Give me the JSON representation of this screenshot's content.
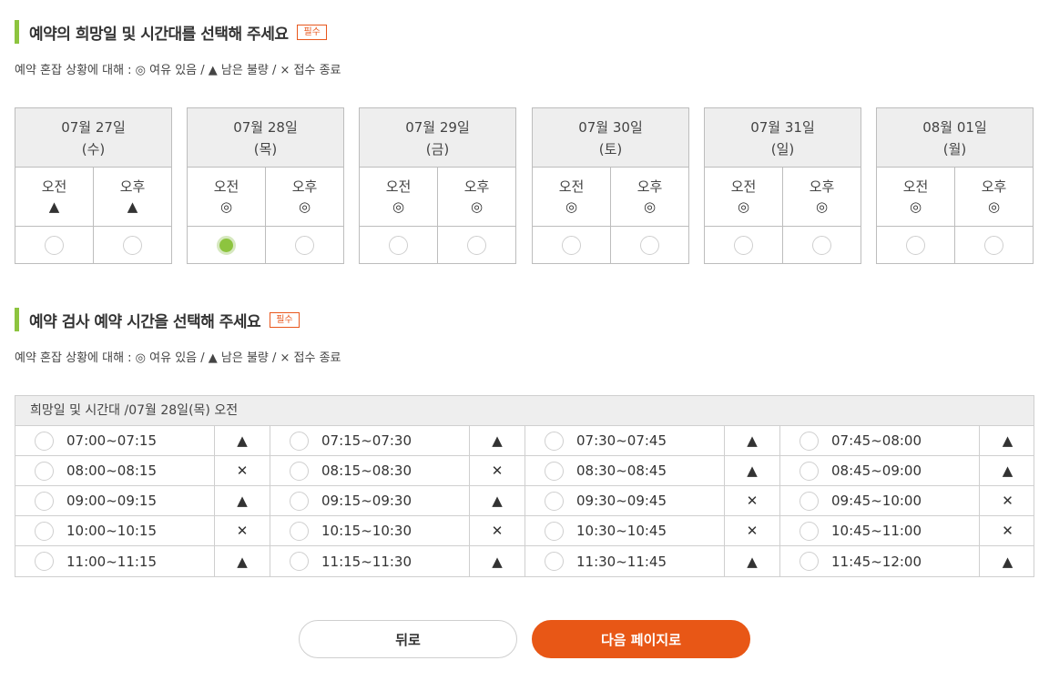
{
  "section1": {
    "title": "예약의 희망일 및 시간대를 선택해 주세요",
    "required": "필수",
    "legend": "예약 혼잡 상황에 대해 : ◎ 여유 있음 / ▲ 남은 불량 / × 접수 종료"
  },
  "days": [
    {
      "date": "07월 27일",
      "weekday": "(수)",
      "am_label": "오전",
      "pm_label": "오후",
      "am_status": "▲",
      "pm_status": "▲",
      "selected": "none"
    },
    {
      "date": "07월 28일",
      "weekday": "(목)",
      "am_label": "오전",
      "pm_label": "오후",
      "am_status": "◎",
      "pm_status": "◎",
      "selected": "am"
    },
    {
      "date": "07월 29일",
      "weekday": "(금)",
      "am_label": "오전",
      "pm_label": "오후",
      "am_status": "◎",
      "pm_status": "◎",
      "selected": "none"
    },
    {
      "date": "07월 30일",
      "weekday": "(토)",
      "am_label": "오전",
      "pm_label": "오후",
      "am_status": "◎",
      "pm_status": "◎",
      "selected": "none"
    },
    {
      "date": "07월 31일",
      "weekday": "(일)",
      "am_label": "오전",
      "pm_label": "오후",
      "am_status": "◎",
      "pm_status": "◎",
      "selected": "none"
    },
    {
      "date": "08월 01일",
      "weekday": "(월)",
      "am_label": "오전",
      "pm_label": "오후",
      "am_status": "◎",
      "pm_status": "◎",
      "selected": "none"
    }
  ],
  "section2": {
    "title": "예약 검사 예약 시간을 선택해 주세요",
    "required": "필수",
    "legend": "예약 혼잡 상황에 대해 : ◎ 여유 있음 / ▲ 남은 불량 / × 접수 종료",
    "table_header": "희망일 및 시간대 /07월 28일(목) 오전"
  },
  "time_rows": [
    [
      {
        "time": "07:00~07:15",
        "status": "▲"
      },
      {
        "time": "07:15~07:30",
        "status": "▲"
      },
      {
        "time": "07:30~07:45",
        "status": "▲"
      },
      {
        "time": "07:45~08:00",
        "status": "▲"
      }
    ],
    [
      {
        "time": "08:00~08:15",
        "status": "✕"
      },
      {
        "time": "08:15~08:30",
        "status": "✕"
      },
      {
        "time": "08:30~08:45",
        "status": "▲"
      },
      {
        "time": "08:45~09:00",
        "status": "▲"
      }
    ],
    [
      {
        "time": "09:00~09:15",
        "status": "▲"
      },
      {
        "time": "09:15~09:30",
        "status": "▲"
      },
      {
        "time": "09:30~09:45",
        "status": "✕"
      },
      {
        "time": "09:45~10:00",
        "status": "✕"
      }
    ],
    [
      {
        "time": "10:00~10:15",
        "status": "✕"
      },
      {
        "time": "10:15~10:30",
        "status": "✕"
      },
      {
        "time": "10:30~10:45",
        "status": "✕"
      },
      {
        "time": "10:45~11:00",
        "status": "✕"
      }
    ],
    [
      {
        "time": "11:00~11:15",
        "status": "▲"
      },
      {
        "time": "11:15~11:30",
        "status": "▲"
      },
      {
        "time": "11:30~11:45",
        "status": "▲"
      },
      {
        "time": "11:45~12:00",
        "status": "▲"
      }
    ]
  ],
  "buttons": {
    "back": "뒤로",
    "next": "다음 페이지로"
  },
  "colors": {
    "accent_green": "#8dc43f",
    "accent_orange": "#e85716"
  }
}
